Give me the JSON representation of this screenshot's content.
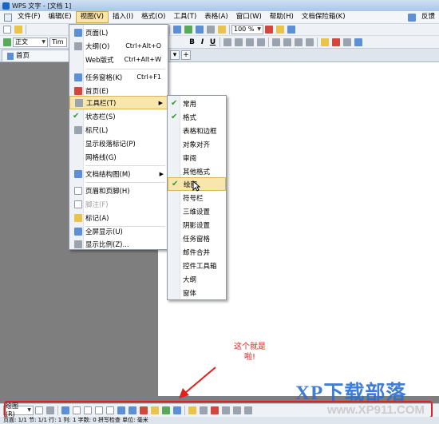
{
  "window": {
    "title": "WPS 文字 - [文档 1]"
  },
  "menubar": {
    "items": [
      "文件(F)",
      "编辑(E)",
      "视图(V)",
      "插入(I)",
      "格式(O)",
      "工具(T)",
      "表格(A)",
      "窗口(W)",
      "帮助(H)",
      "文档保险箱(K)"
    ],
    "active": "视图(V)",
    "feedback": "反馈"
  },
  "toolbar": {
    "style_value": "正文",
    "font_value": "Tim",
    "zoom_value": "100 %"
  },
  "tabs": {
    "home": "首页",
    "new_tab": "+"
  },
  "view_menu": {
    "items": [
      {
        "label": "页面(L)",
        "shortcut": ""
      },
      {
        "label": "大纲(O)",
        "shortcut": "Ctrl+Alt+O"
      },
      {
        "label": "Web版式",
        "shortcut": "Ctrl+Alt+W"
      },
      {
        "label": "任务窗格(K)",
        "shortcut": "Ctrl+F1"
      },
      {
        "label": "首页(E)",
        "shortcut": ""
      },
      {
        "label": "工具栏(T)",
        "shortcut": ""
      },
      {
        "label": "状态栏(S)",
        "shortcut": ""
      },
      {
        "label": "标尺(L)",
        "shortcut": ""
      },
      {
        "label": "显示段落标记(P)",
        "shortcut": ""
      },
      {
        "label": "网格线(G)",
        "shortcut": ""
      },
      {
        "label": "文档结构图(M)",
        "shortcut": ""
      },
      {
        "label": "页眉和页脚(H)",
        "shortcut": ""
      },
      {
        "label": "脚注(F)",
        "shortcut": ""
      },
      {
        "label": "标记(A)",
        "shortcut": ""
      },
      {
        "label": "全屏显示(U)",
        "shortcut": ""
      },
      {
        "label": "显示比例(Z)...",
        "shortcut": ""
      }
    ]
  },
  "toolbar_submenu": {
    "items": [
      "常用",
      "格式",
      "表格和边框",
      "对象对齐",
      "审阅",
      "其他格式",
      "绘图",
      "符号栏",
      "三维设置",
      "阴影设置",
      "任务窗格",
      "邮件合并",
      "控件工具箱",
      "大纲",
      "窗体"
    ],
    "checked": [
      "常用",
      "格式",
      "绘图"
    ]
  },
  "annotation": {
    "line1": "这个就是",
    "line2": "啦!"
  },
  "drawing_toolbar": {
    "draw_label": "绘图(R)"
  },
  "statusbar": {
    "text": "页面: 1/1    节: 1/1    行: 1    列: 1    字数: 0    拼写检查    单位: 毫米"
  },
  "watermark": {
    "logo": "XP下载部落",
    "url": "www.XP911.COM"
  },
  "colors": {
    "accent": "#2c6fd1",
    "highlight": "#f8e7ad",
    "annotation": "#e0201a",
    "check": "#2f9d2f"
  }
}
